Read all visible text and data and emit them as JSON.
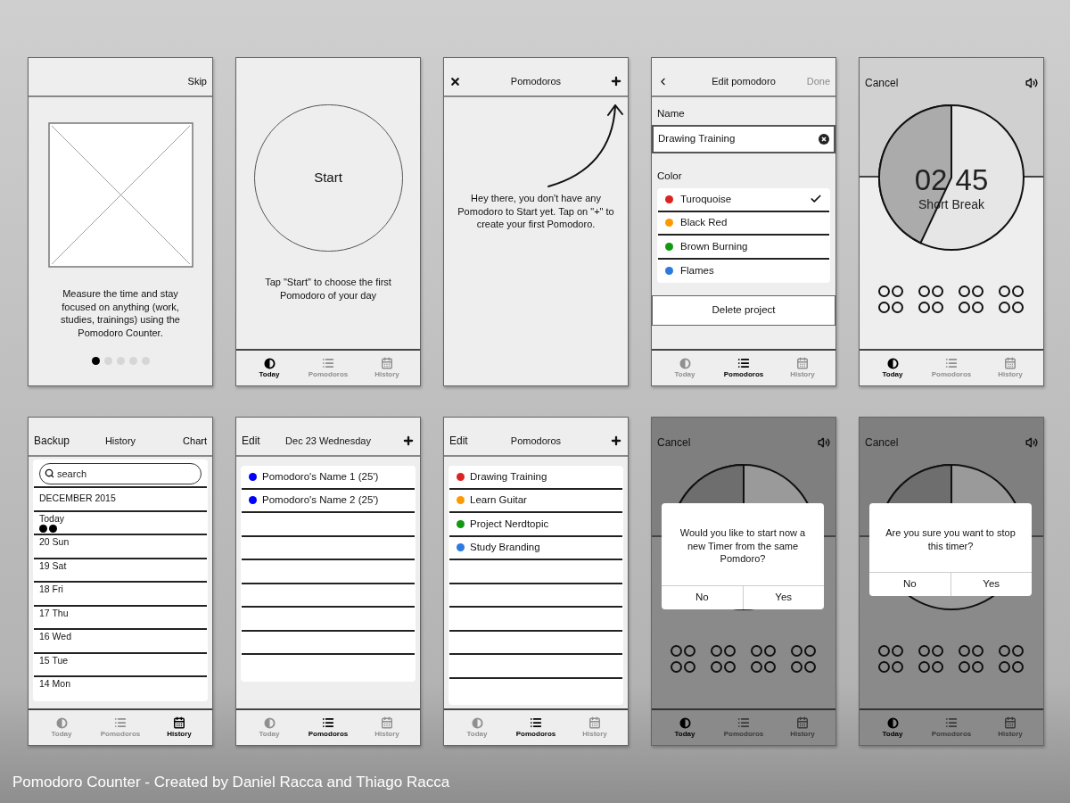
{
  "screens": [
    {
      "kind": "onboarding",
      "header": {
        "right": "Skip"
      },
      "text": "Measure the time and stay focused on anything (work, studies, trainings) using the Pomodoro Counter.",
      "pager": [
        {
          "selected": true
        },
        {
          "selected": false
        },
        {
          "selected": false
        },
        {
          "selected": false
        },
        {
          "selected": false
        }
      ]
    },
    {
      "kind": "start",
      "button": "Start",
      "text": "Tap \"Start\" to choose the first Pomodoro of your day",
      "tabs": [
        {
          "label": "Today",
          "selected": true
        },
        {
          "label": "Pomodoros",
          "selected": false
        },
        {
          "label": "History",
          "selected": false
        }
      ]
    },
    {
      "kind": "empty",
      "header": {
        "title": "Pomodoros"
      },
      "text": "Hey there, you don't have any Pomodoro to Start yet. Tap on \"+\" to create your first Pomodoro."
    },
    {
      "kind": "edit",
      "header": {
        "title": "Edit pomodoro",
        "right": "Done",
        "right_disabled": true
      },
      "name_label": "Name",
      "name_value": "Drawing Training",
      "color_label": "Color",
      "colors": [
        {
          "label": "Turoquoise",
          "color": "#dd2222",
          "selected": true
        },
        {
          "label": "Black Red",
          "color": "#ff9900",
          "selected": false
        },
        {
          "label": "Brown Burning",
          "color": "#119911",
          "selected": false
        },
        {
          "label": "Flames",
          "color": "#2a7ae2",
          "selected": false
        }
      ],
      "delete_button": "Delete project",
      "tabs": [
        {
          "label": "Today",
          "selected": false
        },
        {
          "label": "Pomodoros",
          "selected": true
        },
        {
          "label": "History",
          "selected": false
        }
      ]
    },
    {
      "kind": "timer",
      "header": {
        "left": "Cancel"
      },
      "time": "02 45",
      "label": "Short Break",
      "tabs": [
        {
          "label": "Today",
          "selected": true
        },
        {
          "label": "Pomodoros",
          "selected": false
        },
        {
          "label": "History",
          "selected": false
        }
      ]
    },
    {
      "kind": "history",
      "header": {
        "left": "Backup",
        "title": "History",
        "right": "Chart"
      },
      "search": {
        "placeholder": "search"
      },
      "month": "DECEMBER 2015",
      "days": [
        {
          "label": "Today",
          "marks": [
            {
              "color": "#000000"
            },
            {
              "color": "#000000"
            }
          ]
        },
        {
          "label": "20 Sun"
        },
        {
          "label": "19 Sat"
        },
        {
          "label": "18 Fri"
        },
        {
          "label": "17 Thu"
        },
        {
          "label": "16 Wed"
        },
        {
          "label": "15 Tue"
        },
        {
          "label": "14 Mon"
        }
      ],
      "tabs": [
        {
          "label": "Today",
          "selected": false
        },
        {
          "label": "Pomodoros",
          "selected": false
        },
        {
          "label": "History",
          "selected": true
        }
      ]
    },
    {
      "kind": "day",
      "header": {
        "left": "Edit",
        "title": "Dec 23 Wednesday"
      },
      "items": [
        {
          "label": "Pomodoro's Name 1 (25')",
          "color": "#0000ff"
        },
        {
          "label": "Pomodoro's Name 2 (25')",
          "color": "#0000ff"
        }
      ],
      "tabs": [
        {
          "label": "Today",
          "selected": false
        },
        {
          "label": "Pomodoros",
          "selected": true
        },
        {
          "label": "History",
          "selected": false
        }
      ]
    },
    {
      "kind": "list",
      "header": {
        "left": "Edit",
        "title": "Pomodoros"
      },
      "items": [
        {
          "label": "Drawing Training",
          "color": "#dd2222"
        },
        {
          "label": "Learn Guitar",
          "color": "#ff9900"
        },
        {
          "label": "Project Nerdtopic",
          "color": "#119911"
        },
        {
          "label": "Study Branding",
          "color": "#2a7ae2"
        }
      ],
      "tabs": [
        {
          "label": "Today",
          "selected": false
        },
        {
          "label": "Pomodoros",
          "selected": true
        },
        {
          "label": "History",
          "selected": false
        }
      ]
    },
    {
      "kind": "timer",
      "header": {
        "left": "Cancel"
      },
      "dialog": {
        "text": "Would you like to start now a new Timer from the same Pomdoro?",
        "buttons": [
          "No",
          "Yes"
        ]
      },
      "tabs": [
        {
          "label": "Today",
          "selected": true
        },
        {
          "label": "Pomodoros",
          "selected": false
        },
        {
          "label": "History",
          "selected": false
        }
      ]
    },
    {
      "kind": "timer",
      "header": {
        "left": "Cancel"
      },
      "dialog": {
        "text": "Are you sure you want to stop this timer?",
        "buttons": [
          "No",
          "Yes"
        ]
      },
      "tabs": [
        {
          "label": "Today",
          "selected": true
        },
        {
          "label": "Pomodoros",
          "selected": false
        },
        {
          "label": "History",
          "selected": false
        }
      ]
    }
  ],
  "caption": "Pomodoro Counter - Created by Daniel Racca and Thiago Racca"
}
